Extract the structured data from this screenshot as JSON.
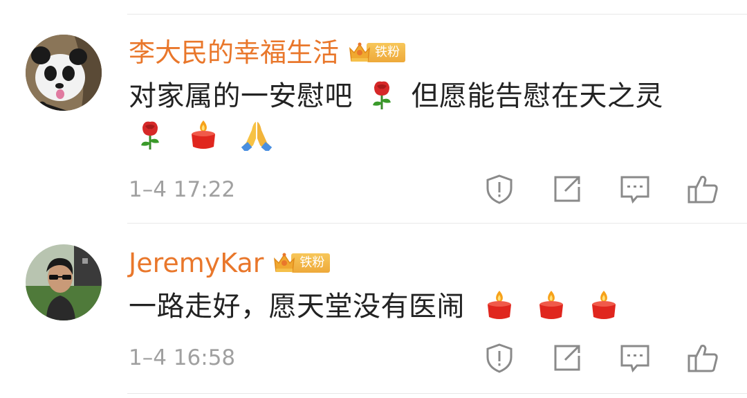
{
  "comments": [
    {
      "username": "李大民的幸福生活",
      "badge": "铁粉",
      "text_line1": "对家属的一安慰吧",
      "text_line1_cont": "但愿能告慰在天之灵",
      "emojis": [
        "rose-emoji",
        "rose-emoji",
        "candle-emoji",
        "folded-hands-emoji"
      ],
      "timestamp": "1–4 17:22",
      "avatar": "panda-avatar"
    },
    {
      "username": "JeremyKar",
      "badge": "铁粉",
      "text": "一路走好，愿天堂没有医闹",
      "emojis": [
        "candle-emoji",
        "candle-emoji",
        "candle-emoji"
      ],
      "timestamp": "1–4 16:58",
      "avatar": "user-photo-avatar"
    }
  ],
  "actions": [
    "report-icon",
    "share-icon",
    "reply-icon",
    "like-icon"
  ],
  "colors": {
    "username": "#e9772b",
    "text": "#222222",
    "meta": "#a0a0a0",
    "icon": "#8a8a8a",
    "divider": "#e8e8e8",
    "badge": "#f0b040"
  }
}
